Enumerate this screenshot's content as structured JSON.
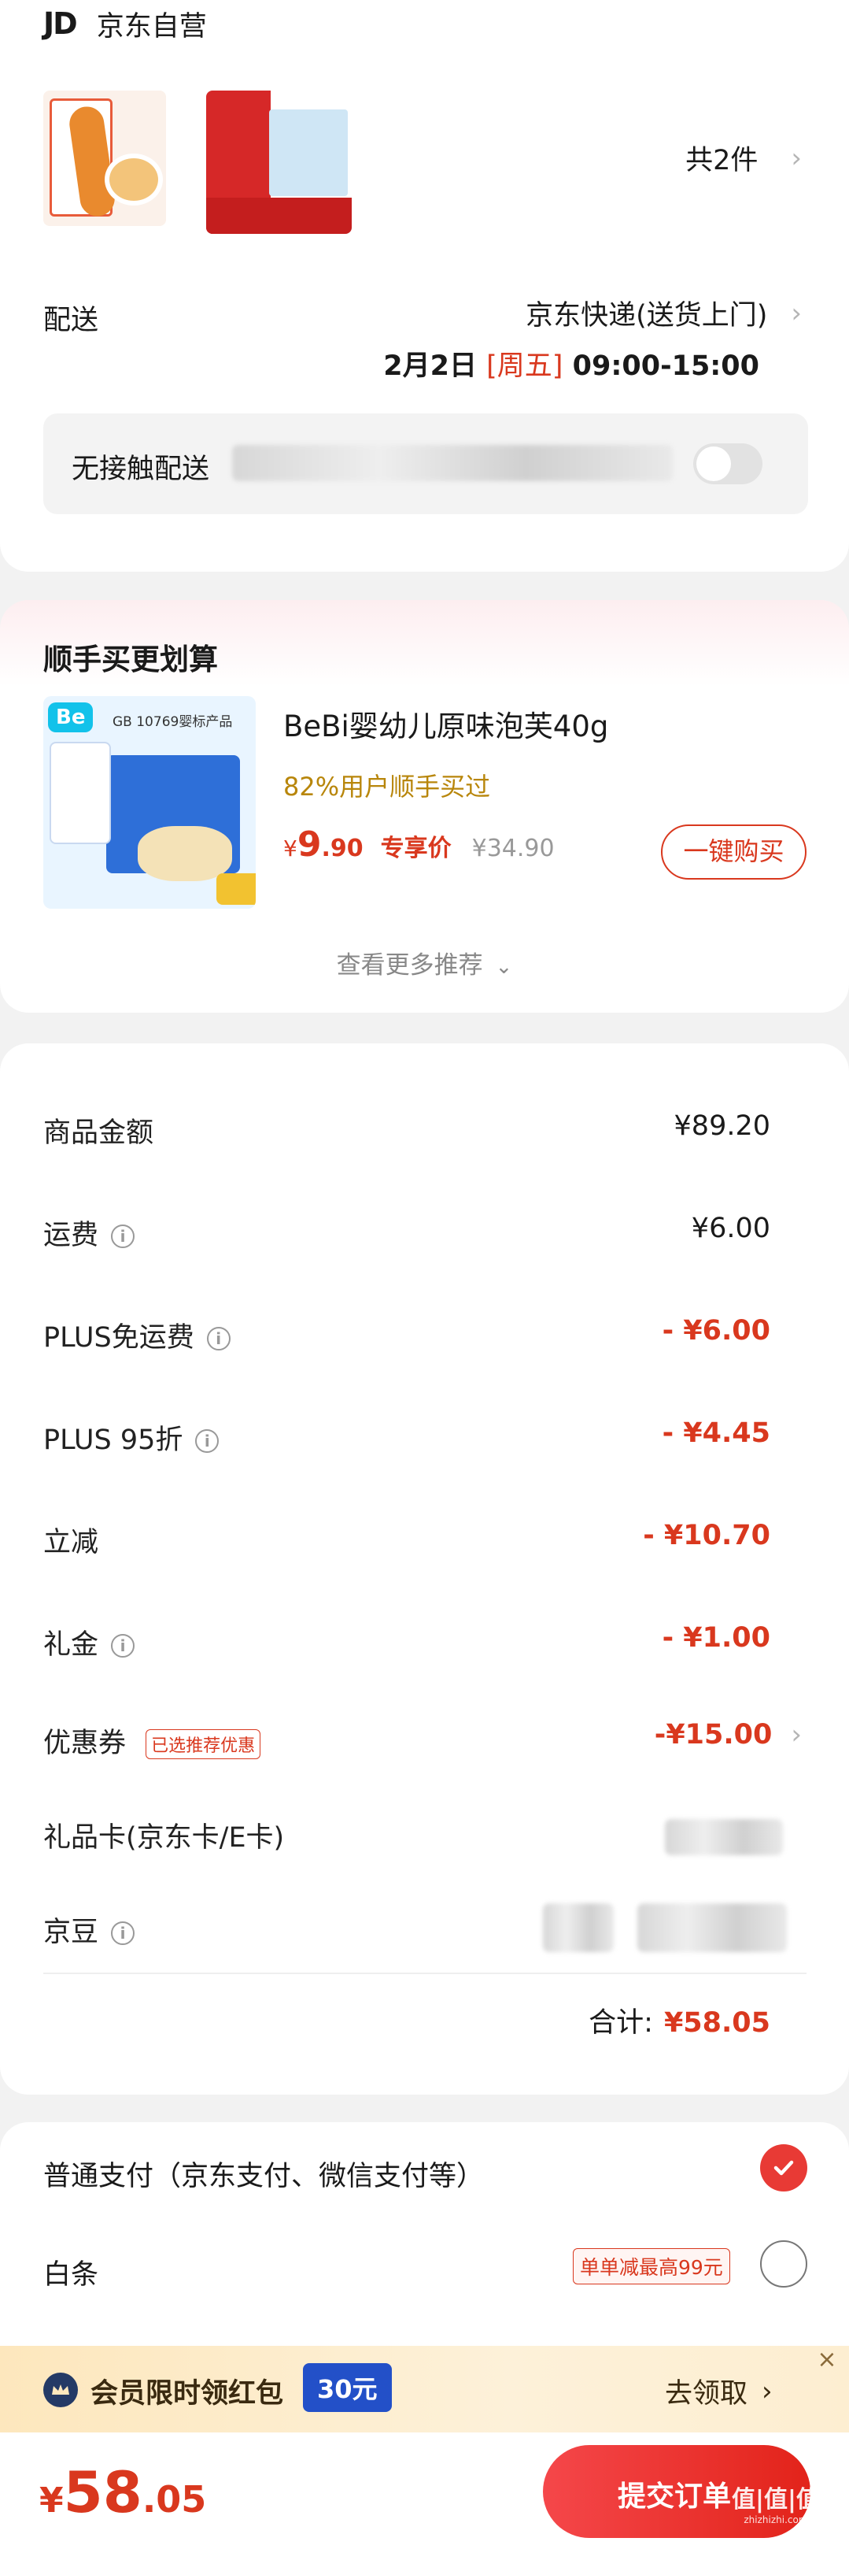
{
  "shop": {
    "logo": "JD",
    "name": "京东自营"
  },
  "products": {
    "count_label": "共2件"
  },
  "delivery": {
    "label": "配送",
    "method": "京东快递(送货上门)",
    "date": "2月2日",
    "weekday": "[周五]",
    "time": "09:00-15:00",
    "contactless_label": "无接触配送"
  },
  "recommend": {
    "title": "顺手买更划算",
    "product_name": "BeBi婴幼儿原味泡芙40g",
    "tag_text": "GB 10769婴标产品",
    "badge": "Be",
    "buy_rate": "82%用户顺手买过",
    "price_symbol": "¥",
    "price_int": "9",
    "price_dec": ".90",
    "price_tag": "专享价",
    "original_price": "¥34.90",
    "buy_button": "一键购买",
    "more": "查看更多推荐"
  },
  "summary": {
    "rows": [
      {
        "label": "商品金额",
        "value": "¥89.20"
      },
      {
        "label": "运费",
        "value": "¥6.00"
      },
      {
        "label": "PLUS免运费",
        "value": "- ¥6.00"
      },
      {
        "label": "PLUS 95折",
        "value": "- ¥4.45"
      },
      {
        "label": "立减",
        "value": "- ¥10.70"
      },
      {
        "label": "礼金",
        "value": "- ¥1.00"
      },
      {
        "label": "优惠券",
        "value": "-¥15.00",
        "tag": "已选推荐优惠"
      },
      {
        "label": "礼品卡(京东卡/E卡)",
        "value": ""
      },
      {
        "label": "京豆",
        "value": ""
      }
    ],
    "total_label": "合计:",
    "total_value": "¥58.05"
  },
  "payment": {
    "normal_label": "普通支付（京东支付、微信支付等）",
    "baitiao_label": "白条",
    "baitiao_tag": "单单减最高99元"
  },
  "banner": {
    "text": "会员限时领红包",
    "amount": "30元",
    "action": "去领取"
  },
  "footer": {
    "price_symbol": "¥",
    "price_int": "58",
    "price_dec": ".05",
    "submit": "提交订单",
    "watermark": "值|值|值",
    "watermark_sub": "zhizhizhi.com"
  },
  "colors": {
    "accent": "#e4393c",
    "price_red": "#d9381e",
    "banner_bg": "#fdecc8",
    "badge_blue": "#2350c8"
  }
}
